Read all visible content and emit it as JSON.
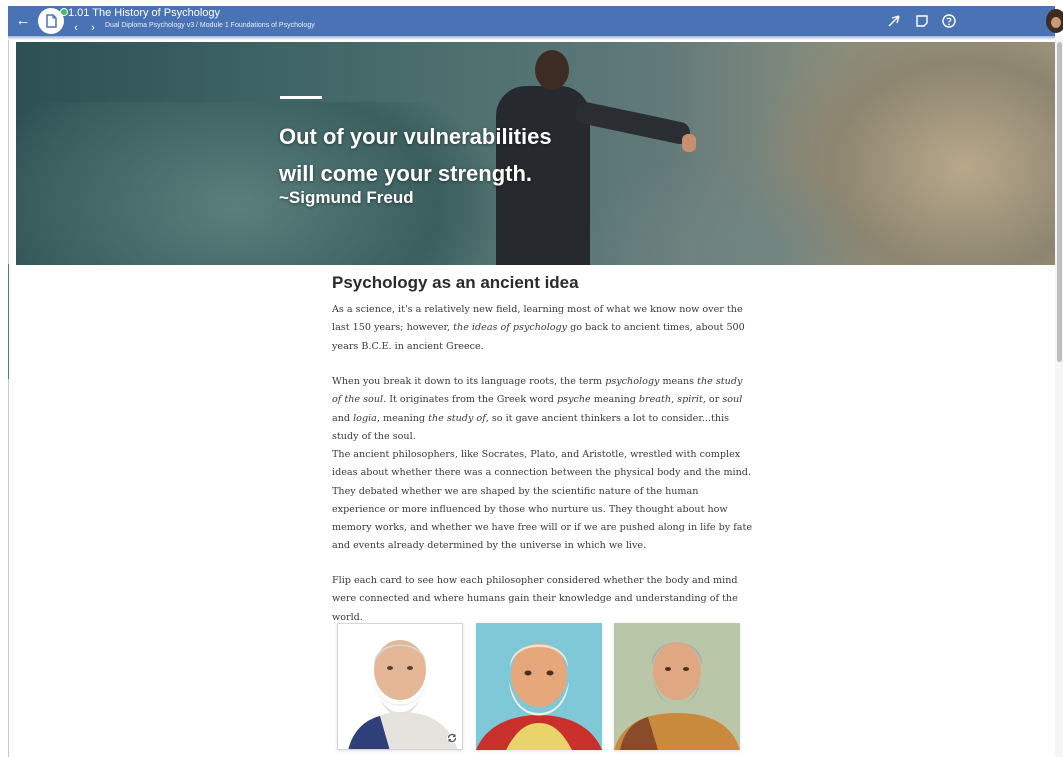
{
  "topbar": {
    "title": "1.01 The History of Psychology",
    "breadcrumb": "Dual Diploma Psychology v3 / Module 1 Foundations of Psychology",
    "back_glyph": "←",
    "prev_glyph": "‹",
    "next_glyph": "›",
    "icons": [
      "back-arrow-icon",
      "document-icon",
      "send-icon",
      "note-icon",
      "help-icon"
    ],
    "accent_color": "#4a73b6",
    "status_color": "#3fbd58"
  },
  "hero": {
    "quote_line1": "Out of your vulnerabilities",
    "quote_line2": "will come your strength.",
    "author": "~Sigmund Freud"
  },
  "content": {
    "heading": "Psychology as an ancient idea",
    "p1": [
      {
        "t": "As a science, it's a relatively new field, learning most of what we know now over the last 150 years; however, "
      },
      {
        "t": "the ideas of psychology",
        "i": true
      },
      {
        "t": " go back to ancient times, about 500 years B.C.E. in ancient Greece."
      }
    ],
    "p2": [
      {
        "t": "When you break it down to its language roots, the term "
      },
      {
        "t": "psychology",
        "i": true
      },
      {
        "t": " means "
      },
      {
        "t": "the study of the soul",
        "i": true
      },
      {
        "t": ".  It originates from the Greek word "
      },
      {
        "t": "psyche",
        "i": true
      },
      {
        "t": " meaning "
      },
      {
        "t": "breath",
        "i": true
      },
      {
        "t": ", "
      },
      {
        "t": "spirit",
        "i": true
      },
      {
        "t": ", or "
      },
      {
        "t": "soul",
        "i": true
      },
      {
        "t": " and "
      },
      {
        "t": "logia",
        "i": true
      },
      {
        "t": ", meaning "
      },
      {
        "t": "the study of",
        "i": true
      },
      {
        "t": ", so it gave ancient thinkers a lot to consider...this study of the soul."
      }
    ],
    "p3": "The ancient philosophers, like Socrates, Plato, and Aristotle, wrestled with complex ideas about whether there was a connection between the physical body and the mind. They debated whether we are shaped by the scientific nature of the human experience or more influenced by those who nurture us. They thought about how memory works, and whether we have free will or if we are pushed along in life by fate and events already determined by the universe in which we live.",
    "p4": "Flip each card to see how each philosopher considered whether the body and mind were connected and where humans gain their knowledge and understanding of the world."
  },
  "cards": [
    {
      "portrait": "socrates-portrait",
      "has_flip_icon": true
    },
    {
      "portrait": "plato-portrait",
      "has_flip_icon": false
    },
    {
      "portrait": "aristotle-portrait",
      "has_flip_icon": false
    }
  ]
}
